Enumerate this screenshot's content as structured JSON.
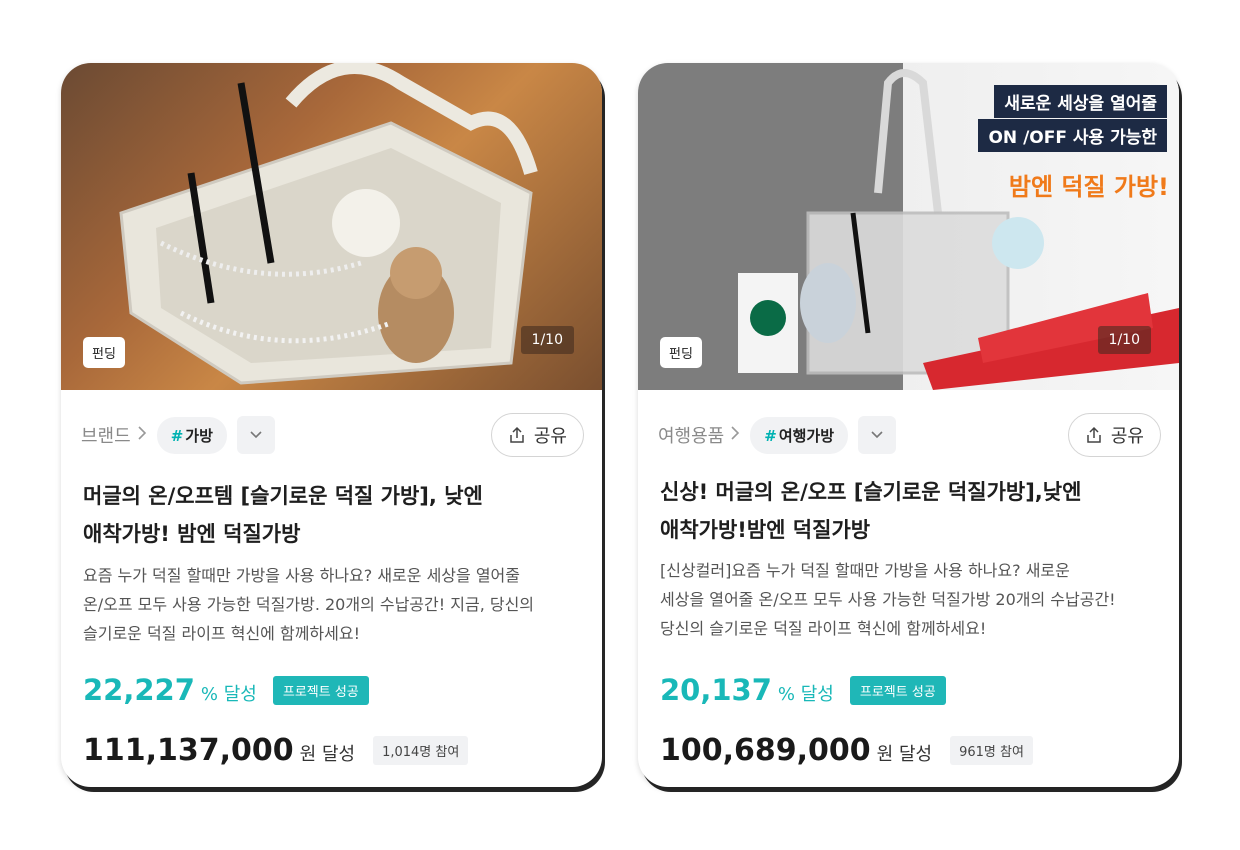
{
  "cards": [
    {
      "badge": "펀딩",
      "image_counter": "1/10",
      "category": "브랜드",
      "tag": "가방",
      "share_label": "공유",
      "title_line1": "머글의 온/오프템 [슬기로운 덕질 가방], 낮엔",
      "title_line2": "애착가방! 밤엔 덕질가방",
      "desc_line1": "요즘 누가 덕질 할때만 가방을 사용 하나요? 새로운 세상을 열어줄",
      "desc_line2": "온/오프 모두 사용 가능한 덕질가방. 20개의 수납공간! 지금, 당신의",
      "desc_line3": "슬기로운 덕질 라이프 혁신에 함께하세요!",
      "percent": "22,227",
      "percent_unit": "% 달성",
      "status": "프로젝트 성공",
      "amount": "111,137,000",
      "amount_unit": "원 달성",
      "participants": "1,014명 참여"
    },
    {
      "badge": "펀딩",
      "image_counter": "1/10",
      "ad_line1": "새로운 세상을 열어줄",
      "ad_line2": "ON /OFF 사용 가능한",
      "ad_line3": "밤엔 덕질 가방!",
      "category": "여행용품",
      "tag": "여행가방",
      "share_label": "공유",
      "title_line1": "신상! 머글의 온/오프 [슬기로운 덕질가방],낮엔",
      "title_line2": "애착가방!밤엔 덕질가방",
      "desc_line1": "[신상컬러]요즘 누가 덕질 할때만 가방을 사용 하나요? 새로운",
      "desc_line2": "세상을 열어줄 온/오프 모두 사용 가능한 덕질가방 20개의 수납공간!",
      "desc_line3": "당신의 슬기로운 덕질 라이프 혁신에 함께하세요!",
      "percent": "20,137",
      "percent_unit": "% 달성",
      "status": "프로젝트 성공",
      "amount": "100,689,000",
      "amount_unit": "원 달성",
      "participants": "961명 참여"
    }
  ],
  "icons": {
    "breadcrumb": "chevron-right-icon",
    "dropdown": "chevron-down-icon",
    "share": "share-icon"
  },
  "colors": {
    "accent": "#19b8b8",
    "status_bg": "#1fb7b7",
    "ad_banner": "#1d2a44",
    "ad_highlight": "#f07a1a"
  }
}
